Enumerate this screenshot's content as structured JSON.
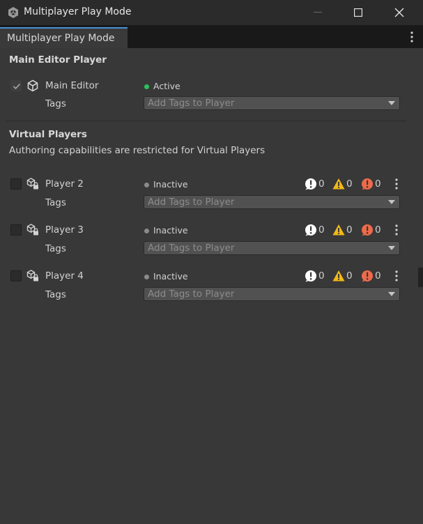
{
  "window": {
    "title": "Multiplayer Play Mode",
    "controls": [
      "minimize-icon",
      "maximize-icon",
      "close-icon"
    ]
  },
  "tab": {
    "label": "Multiplayer Play Mode"
  },
  "main_editor": {
    "section_title": "Main Editor Player",
    "player": {
      "name": "Main Editor",
      "checked": true,
      "status": "Active",
      "status_color": "#27c35a",
      "tags_label": "Tags",
      "tags_placeholder": "Add Tags to Player"
    }
  },
  "virtual": {
    "section_title": "Virtual Players",
    "notice": "Authoring capabilities are restricted for Virtual Players",
    "players": [
      {
        "name": "Player 2",
        "checked": false,
        "status": "Inactive",
        "tags_label": "Tags",
        "tags_placeholder": "Add Tags to Player",
        "info": "0",
        "warnings": "0",
        "errors": "0"
      },
      {
        "name": "Player 3",
        "checked": false,
        "status": "Inactive",
        "tags_label": "Tags",
        "tags_placeholder": "Add Tags to Player",
        "info": "0",
        "warnings": "0",
        "errors": "0"
      },
      {
        "name": "Player 4",
        "checked": false,
        "status": "Inactive",
        "tags_label": "Tags",
        "tags_placeholder": "Add Tags to Player",
        "info": "0",
        "warnings": "0",
        "errors": "0"
      }
    ],
    "inactive_color": "#8a8a8a"
  },
  "colors": {
    "accent": "#4a8fd6",
    "info": "#ffffff",
    "warning": "#f2b814",
    "error": "#ef6a4b"
  }
}
